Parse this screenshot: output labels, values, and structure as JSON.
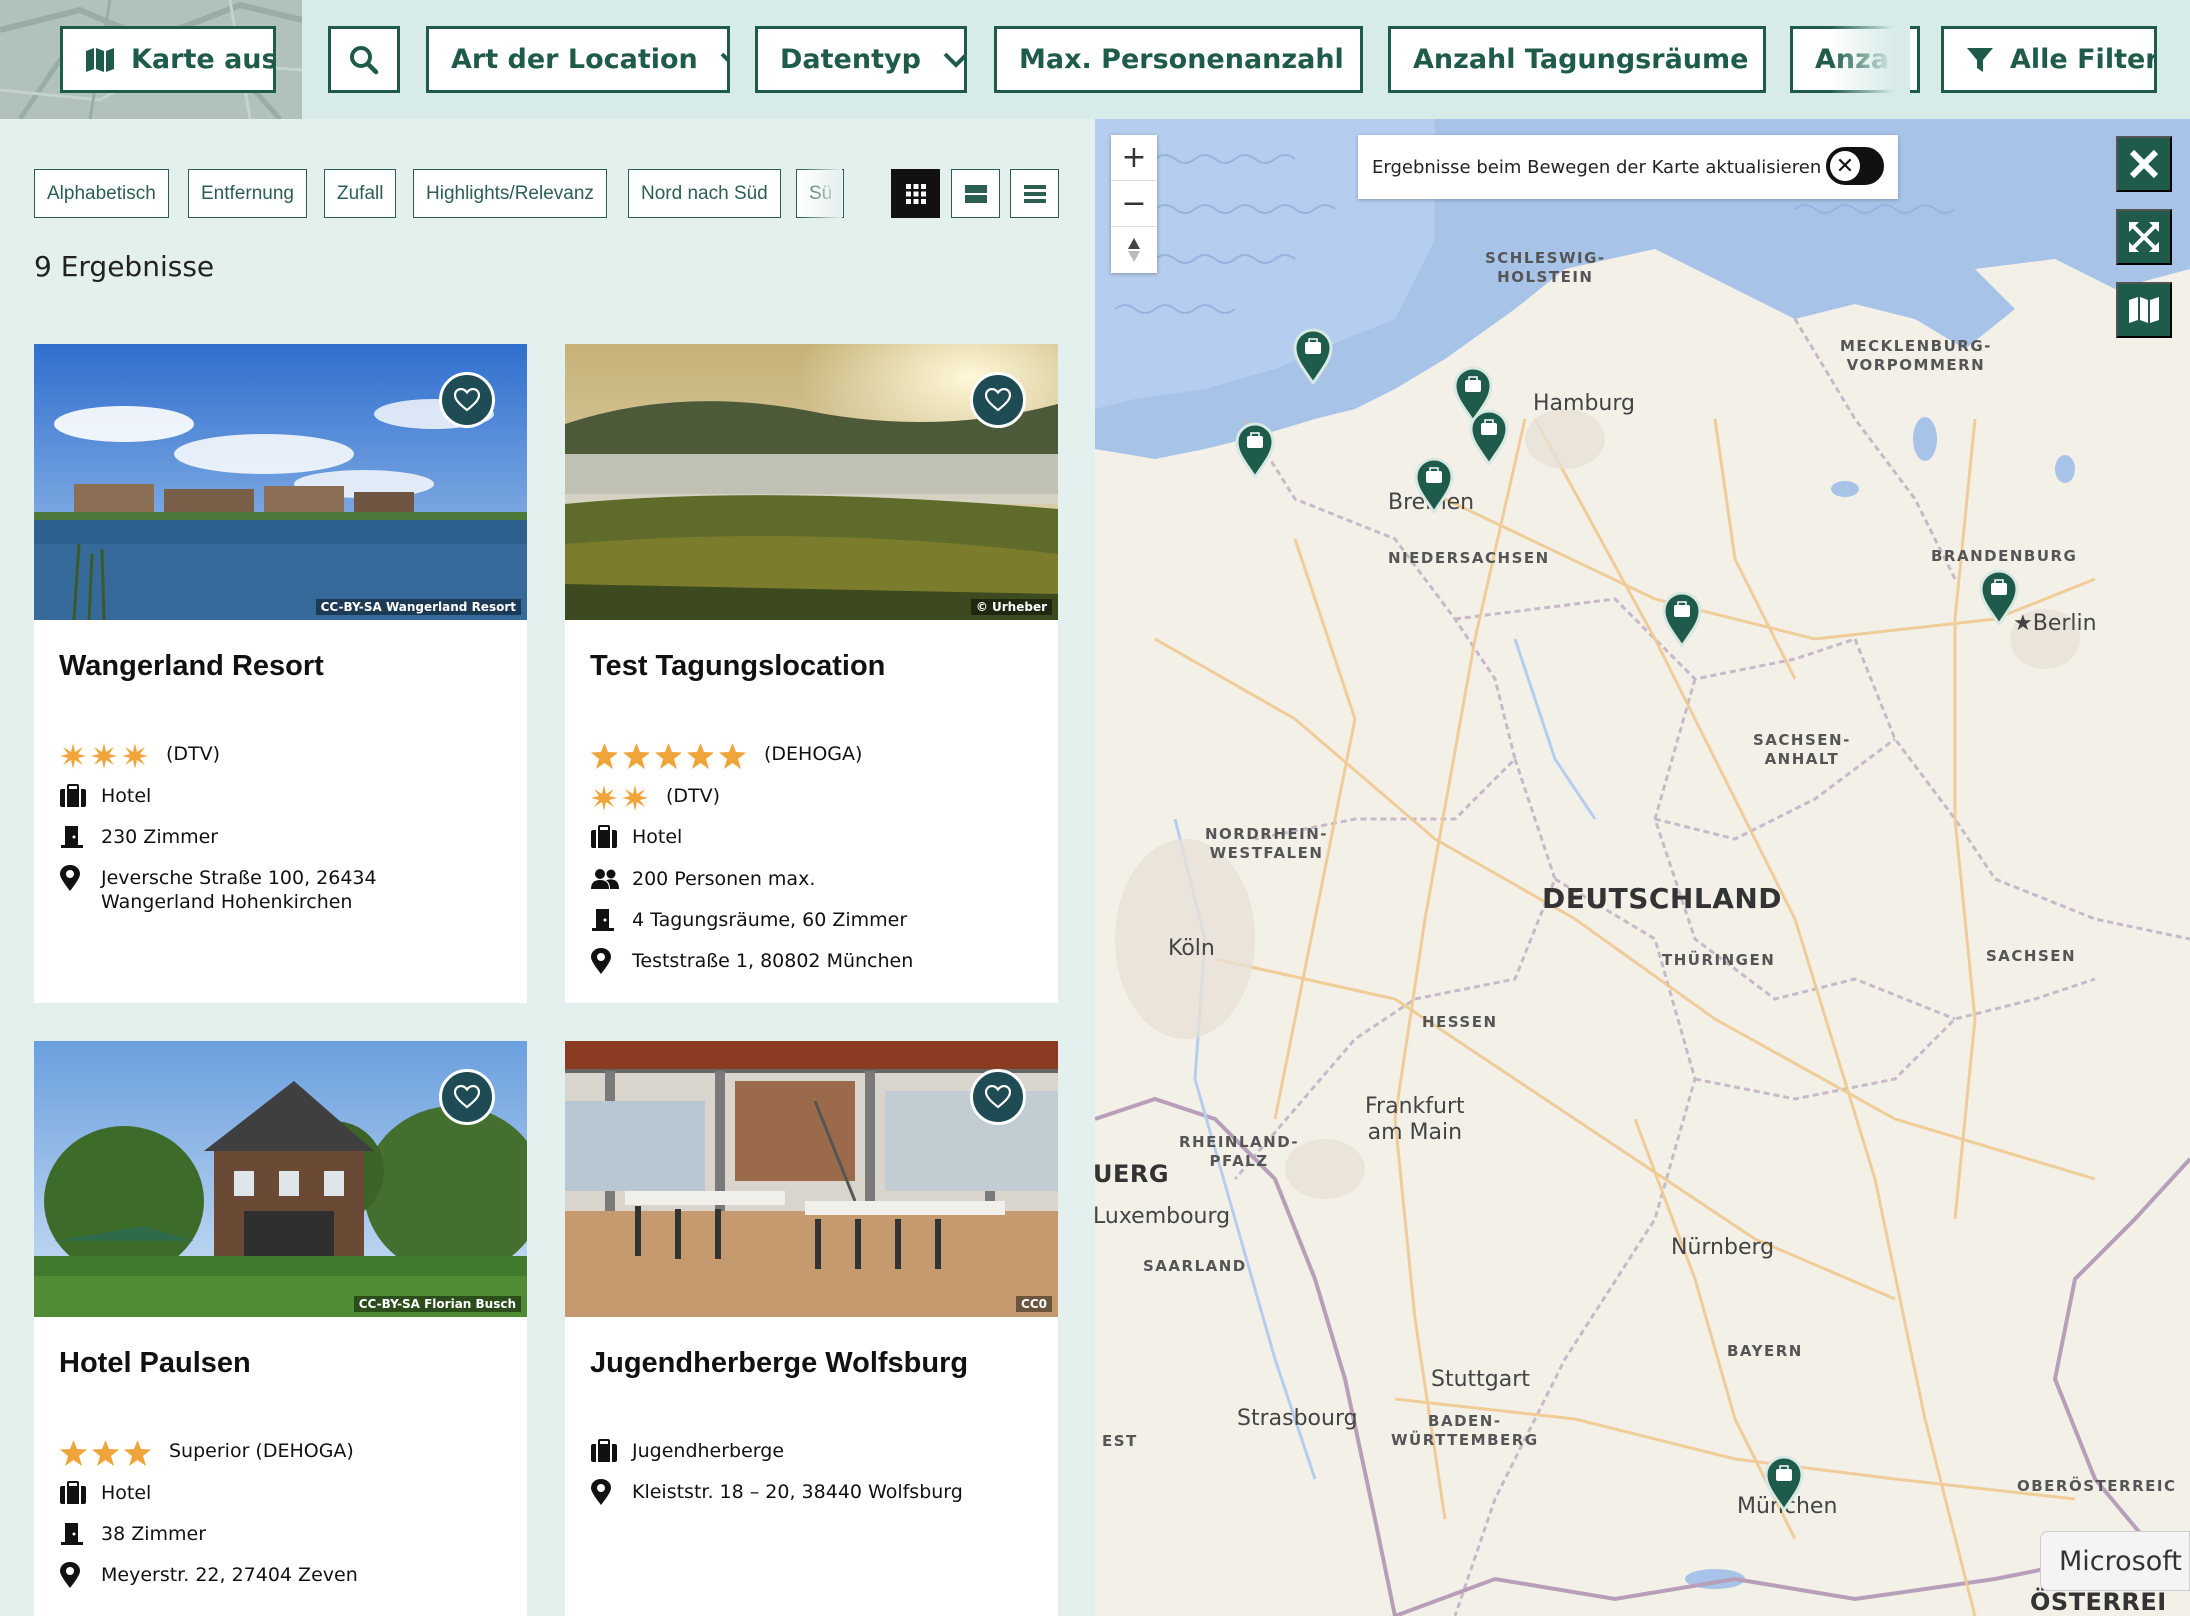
{
  "filters": {
    "map_toggle_label": "Karte aus",
    "location_type_label": "Art der Location",
    "data_type_label": "Datentyp",
    "max_persons_label": "Max. Personenanzahl",
    "meeting_rooms_label": "Anzahl Tagungsräume",
    "more_label": "Anza",
    "all_filters_label": "Alle Filter"
  },
  "sort": {
    "options": [
      "Alphabetisch",
      "Entfernung",
      "Zufall",
      "Highlights/Relevanz",
      "Nord nach Süd",
      "Sü"
    ]
  },
  "results": {
    "count_text": "9 Ergebnisse"
  },
  "cards": [
    {
      "title": "Wangerland Resort",
      "credit": "CC-BY-SA Wangerland Resort",
      "rating": {
        "stars": 3,
        "star_style": "dtv",
        "label": "(DTV)"
      },
      "type": "Hotel",
      "rooms": "230 Zimmer",
      "address": "Jeversche Straße 100, 26434 Wangerland Hohenkirchen"
    },
    {
      "title": "Test Tagungslocation",
      "credit": "© Urheber",
      "rating": {
        "stars": 5,
        "star_style": "dehoga",
        "label": "(DEHOGA)"
      },
      "rating2": {
        "stars": 2,
        "star_style": "dtv",
        "label": "(DTV)"
      },
      "type": "Hotel",
      "persons": "200 Personen max.",
      "rooms": "4 Tagungsräume, 60 Zimmer",
      "address": "Teststraße 1, 80802 München"
    },
    {
      "title": "Hotel Paulsen",
      "credit": "CC-BY-SA Florian Busch",
      "rating": {
        "stars": 3,
        "star_style": "dehoga",
        "label": "Superior (DEHOGA)"
      },
      "type": "Hotel",
      "rooms": "38 Zimmer",
      "address": "Meyerstr. 22, 27404 Zeven"
    },
    {
      "title": "Jugendherberge Wolfsburg",
      "credit": "CC0",
      "type": "Jugendherberge",
      "address": "Kleiststr. 18 – 20, 38440 Wolfsburg"
    }
  ],
  "map": {
    "toggle_text": "Ergebnisse beim Bewegen der Karte aktualisieren",
    "attribution": "Microsoft",
    "labels": {
      "schleswig_holstein": "SCHLESWIG-\nHOLSTEIN",
      "mecklenburg": "MECKLENBURG-\nVORPOMMERN",
      "hamburg": "Hamburg",
      "bremen": "Bremen",
      "niedersachsen": "NIEDERSACHSEN",
      "brandenburg": "BRANDENBURG",
      "berlin": "Berlin",
      "sachsen_anhalt": "SACHSEN-\nANHALT",
      "nrw": "NORDRHEIN-\nWESTFALEN",
      "deutschland": "DEUTSCHLAND",
      "koeln": "Köln",
      "thueringen": "THÜRINGEN",
      "sachsen": "SACHSEN",
      "hessen": "HESSEN",
      "frankfurt": "Frankfurt\nam Main",
      "rheinland_pfalz": "RHEINLAND-\nPFALZ",
      "uerg": "UERG",
      "luxembourg": "Luxembourg",
      "saarland": "SAARLAND",
      "nuernberg": "Nürnberg",
      "bayern": "BAYERN",
      "stuttgart": "Stuttgart",
      "strasbourg": "Strasbourg",
      "bw": "BADEN-\nWÜRTTEMBERG",
      "est": "EST",
      "muenchen": "München",
      "oesterreich": "OBERÖSTERREIC",
      "oesterrei": "ÖSTERREI"
    }
  },
  "colors": {
    "primary": "#1f5b4b",
    "star": "#f0a53a",
    "background": "#e4f0ee"
  }
}
